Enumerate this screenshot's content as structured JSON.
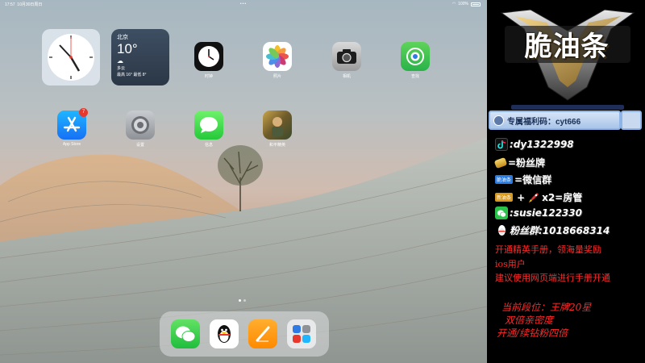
{
  "status_bar": {
    "time": "17:57",
    "date": "10月30日周日",
    "battery": "100%"
  },
  "weather": {
    "city": "北京",
    "temp": "10°",
    "condition": "多云",
    "range": "最高 16° 最低 8°"
  },
  "apps": [
    {
      "label": "时钟"
    },
    {
      "label": "照片"
    },
    {
      "label": "相机"
    },
    {
      "label": "查找"
    },
    {
      "label": "App Store",
      "badge": "7"
    },
    {
      "label": "设置"
    },
    {
      "label": "信息"
    },
    {
      "label": "和平精英"
    }
  ],
  "dock": [
    "微信",
    "QQ",
    "Pages",
    "App 资源库"
  ],
  "overlay": {
    "logo": "脆油条",
    "welfare_code": "专属福利码：cyt666",
    "douyin": ":dy1322998",
    "fans_badge": "=粉丝牌",
    "tag_brand": "脆油条",
    "wechat_group": "=微信群",
    "tag_fans": "新油条",
    "room_manager": "x2=房管",
    "wechat_id": ":susie122330",
    "fans_group": "粉丝群:1018668314",
    "promo1": "开通精英手册，领海量奖励",
    "promo2": "ios用户",
    "promo3": "建议使用网页端进行手册开通",
    "rank1": "当前段位：王牌20星",
    "rank2": "双倍亲密度",
    "rank3": "开通/续钻粉四倍"
  },
  "colors": {
    "promo_red": "#ff2a2a",
    "panel_bg": "#000000",
    "welfare_border": "#8fb4e8"
  }
}
